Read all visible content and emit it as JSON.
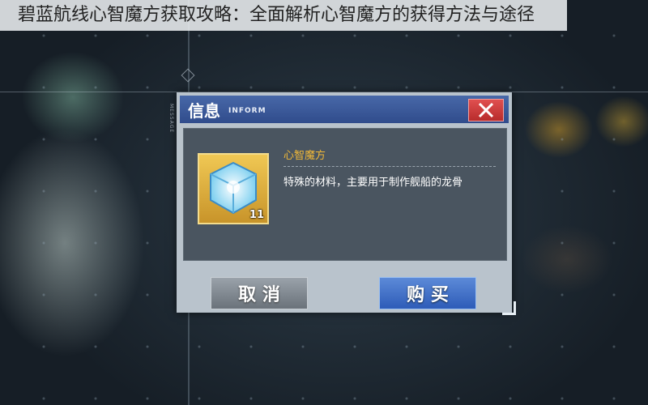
{
  "caption": "碧蓝航线心智魔方获取攻略：全面解析心智魔方的获得方法与途径",
  "side_tag": "MESSAGE",
  "dialog": {
    "title": "信息",
    "subtitle": "INFORM",
    "item": {
      "name": "心智魔方",
      "description": "特殊的材料，主要用于制作舰船的龙骨",
      "count": "11",
      "icon": "cube-icon"
    },
    "buttons": {
      "cancel": "取 消",
      "buy": "购 买"
    }
  },
  "colors": {
    "header": "#3a5a9c",
    "close": "#c83838",
    "item_name": "#f0b838",
    "buy": "#3e6cc8",
    "cancel": "#80888f"
  }
}
